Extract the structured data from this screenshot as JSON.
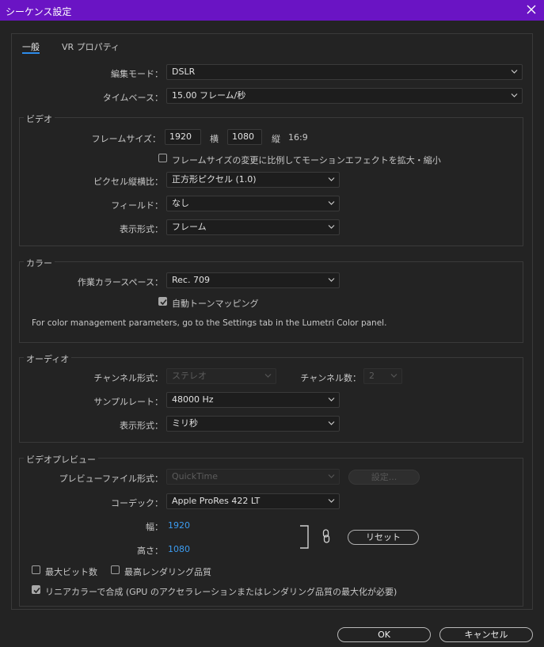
{
  "window": {
    "title": "シーケンス設定"
  },
  "tabs": [
    {
      "label": "一般"
    },
    {
      "label": "VR プロパティ"
    }
  ],
  "general": {
    "edit_mode": {
      "label": "編集モード：",
      "value": "DSLR"
    },
    "timebase": {
      "label": "タイムベース：",
      "value": "15.00  フレーム/秒"
    }
  },
  "video": {
    "title": "ビデオ",
    "frame_size": {
      "label": "フレームサイズ：",
      "width": "1920",
      "width_unit": "横",
      "height": "1080",
      "height_unit": "縦",
      "aspect": "16:9"
    },
    "scale_checkbox": {
      "label": "フレームサイズの変更に比例してモーションエフェクトを拡大・縮小",
      "checked": false
    },
    "pixel_aspect": {
      "label": "ピクセル縦横比：",
      "value": "正方形ピクセル (1.0)"
    },
    "field": {
      "label": "フィールド：",
      "value": "なし"
    },
    "display_format": {
      "label": "表示形式：",
      "value": "フレーム"
    }
  },
  "color": {
    "title": "カラー",
    "working_space": {
      "label": "作業カラースペース：",
      "value": "Rec. 709"
    },
    "auto_tone_mapping": {
      "label": "自動トーンマッピング",
      "checked": true
    },
    "note": "For color management parameters, go to the Settings tab in the Lumetri Color panel."
  },
  "audio": {
    "title": "オーディオ",
    "channel_format": {
      "label": "チャンネル形式：",
      "value": "ステレオ"
    },
    "channel_count": {
      "label": "チャンネル数：",
      "value": "2"
    },
    "sample_rate": {
      "label": "サンプルレート：",
      "value": "48000 Hz"
    },
    "display_format": {
      "label": "表示形式：",
      "value": "ミリ秒"
    }
  },
  "preview": {
    "title": "ビデオプレビュー",
    "file_format": {
      "label": "プレビューファイル形式：",
      "value": "QuickTime",
      "settings_button": "設定..."
    },
    "codec": {
      "label": "コーデック：",
      "value": "Apple ProRes 422 LT"
    },
    "width": {
      "label": "幅：",
      "value": "1920"
    },
    "height": {
      "label": "高さ：",
      "value": "1080"
    },
    "reset_button": "リセット",
    "max_bit_depth": {
      "label": "最大ビット数",
      "checked": false
    },
    "max_render_quality": {
      "label": "最高レンダリング品質",
      "checked": false
    },
    "linear_color": {
      "label": "リニアカラーで合成 (GPU のアクセラレーションまたはレンダリング品質の最大化が必要)",
      "checked": true
    }
  },
  "footer": {
    "ok": "OK",
    "cancel": "キャンセル"
  },
  "colors": {
    "titlebar": "#6a14c4",
    "accent": "#2d8ceb",
    "link_value": "#3c9cf0",
    "background": "#232323"
  }
}
